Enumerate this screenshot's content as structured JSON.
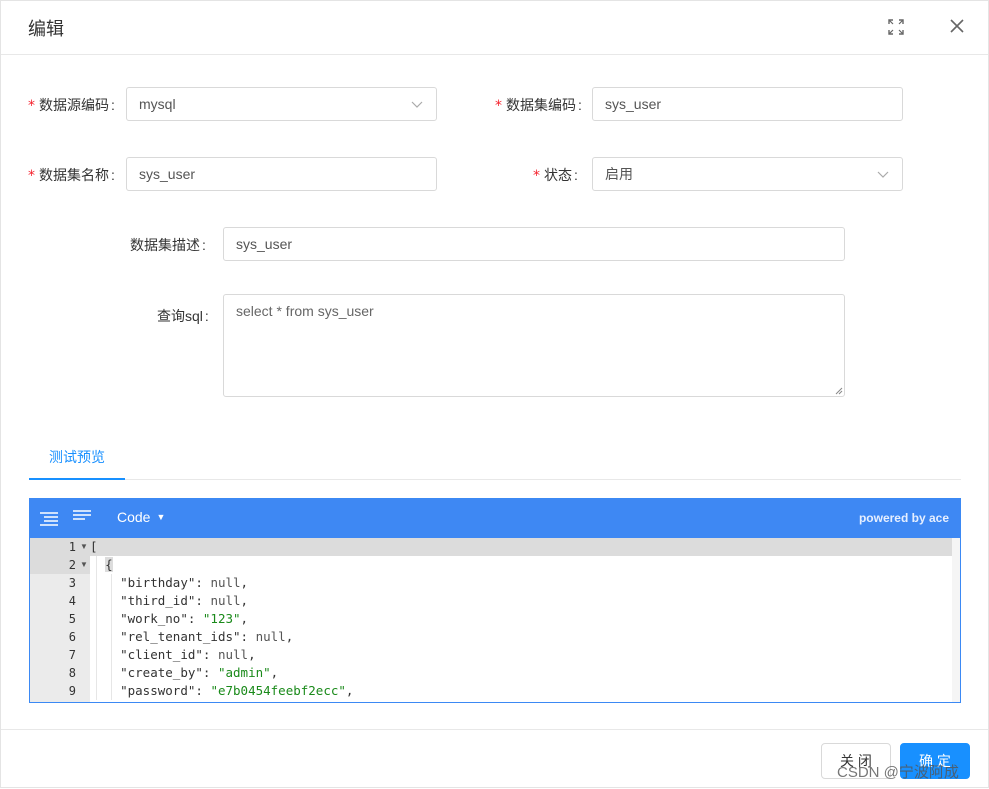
{
  "dialog": {
    "title": "编辑"
  },
  "form": {
    "datasource_code": {
      "label": "数据源编码",
      "value": "mysql",
      "required": true
    },
    "dataset_code": {
      "label": "数据集编码",
      "value": "sys_user",
      "required": true
    },
    "dataset_name": {
      "label": "数据集名称",
      "value": "sys_user",
      "required": true
    },
    "status": {
      "label": "状态",
      "value": "启用",
      "required": true
    },
    "dataset_desc": {
      "label": "数据集描述",
      "value": "sys_user",
      "required": false
    },
    "query_sql": {
      "label": "查询sql",
      "value": "select * from sys_user",
      "required": false
    },
    "colon": ":",
    "required_mark": "*"
  },
  "tabs": [
    {
      "label": "测试预览",
      "active": true
    }
  ],
  "editor": {
    "mode_label": "Code",
    "powered_by": "powered by ace",
    "icons": [
      "format-icon",
      "compact-icon"
    ],
    "lines": [
      {
        "num": "1",
        "fold": true,
        "text": "["
      },
      {
        "num": "2",
        "fold": true,
        "text": "{"
      },
      {
        "num": "3",
        "key": "\"birthday\"",
        "val": "null",
        "val_type": "null",
        "tail": ","
      },
      {
        "num": "4",
        "key": "\"third_id\"",
        "val": "null",
        "val_type": "null",
        "tail": ","
      },
      {
        "num": "5",
        "key": "\"work_no\"",
        "val": "\"123\"",
        "val_type": "string",
        "tail": ","
      },
      {
        "num": "6",
        "key": "\"rel_tenant_ids\"",
        "val": "null",
        "val_type": "null",
        "tail": ","
      },
      {
        "num": "7",
        "key": "\"client_id\"",
        "val": "null",
        "val_type": "null",
        "tail": ","
      },
      {
        "num": "8",
        "key": "\"create_by\"",
        "val": "\"admin\"",
        "val_type": "string",
        "tail": ","
      },
      {
        "num": "9",
        "key": "\"password\"",
        "val": "\"e7b0454feebf2ecc\"",
        "val_type": "string",
        "tail": ","
      }
    ]
  },
  "footer": {
    "close_label": "关 闭",
    "ok_label": "确 定"
  },
  "watermark": "CSDN @宁波阿成",
  "colors": {
    "primary": "#1890ff",
    "editor_bar": "#3e88f3",
    "required": "#f5222d",
    "json_string": "#1a8a1a"
  }
}
